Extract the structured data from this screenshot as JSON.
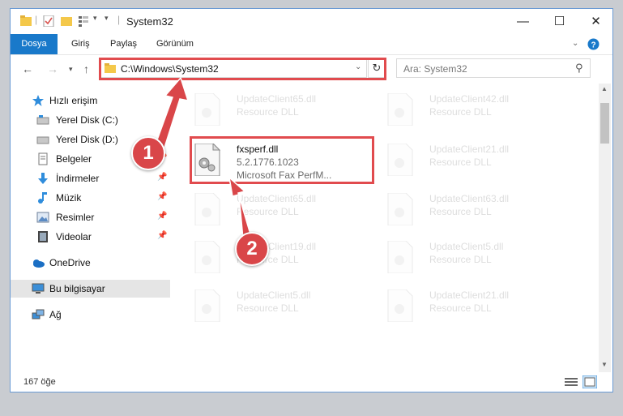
{
  "window": {
    "title": "System32"
  },
  "window_controls": {
    "minimize": "—",
    "maximize": "☐",
    "close": "✕"
  },
  "ribbon": {
    "tabs": [
      "Dosya",
      "Giriş",
      "Paylaş",
      "Görünüm"
    ]
  },
  "address_bar": {
    "path": "C:\\Windows\\System32"
  },
  "search": {
    "placeholder": "Ara: System32"
  },
  "sidebar": {
    "items": [
      {
        "label": "Hızlı erişim",
        "icon": "star-icon"
      },
      {
        "label": "Yerel Disk (C:)",
        "icon": "drive-icon"
      },
      {
        "label": "Yerel Disk (D:)",
        "icon": "drive-icon"
      },
      {
        "label": "Belgeler",
        "icon": "documents-icon",
        "pinned": true
      },
      {
        "label": "İndirmeler",
        "icon": "download-icon",
        "pinned": true
      },
      {
        "label": "Müzik",
        "icon": "music-icon",
        "pinned": true
      },
      {
        "label": "Resimler",
        "icon": "pictures-icon",
        "pinned": true
      },
      {
        "label": "Videolar",
        "icon": "videos-icon",
        "pinned": true
      },
      {
        "label": "OneDrive",
        "icon": "cloud-icon"
      },
      {
        "label": "Bu bilgisayar",
        "icon": "computer-icon",
        "selected": true
      },
      {
        "label": "Ağ",
        "icon": "network-icon"
      }
    ]
  },
  "files": {
    "left": [
      {
        "name": "UpdateClient65.dll",
        "type": "Resource DLL"
      },
      {
        "name": "fxsperf.dll",
        "version": "5.2.1776.1023",
        "desc": "Microsoft Fax PerfM..."
      },
      {
        "name": "UpdateClient65.dll",
        "type": "Resource DLL"
      },
      {
        "name": "UpdateClient19.dll",
        "type": "Resource DLL"
      },
      {
        "name": "UpdateClient5.dll",
        "type": "Resource DLL"
      }
    ],
    "right": [
      {
        "name": "UpdateClient42.dll",
        "type": "Resource DLL"
      },
      {
        "name": "UpdateClient21.dll",
        "type": "Resource DLL"
      },
      {
        "name": "UpdateClient63.dll",
        "type": "Resource DLL"
      },
      {
        "name": "UpdateClient5.dll",
        "type": "Resource DLL"
      },
      {
        "name": "UpdateClient21.dll",
        "type": "Resource DLL"
      }
    ]
  },
  "status": {
    "item_count": "167 öğe"
  },
  "annotations": {
    "badge1": "1",
    "badge2": "2"
  },
  "colors": {
    "accent": "#1979ca",
    "highlight": "#e14b4e",
    "selected_bg": "#e5e5e5"
  }
}
